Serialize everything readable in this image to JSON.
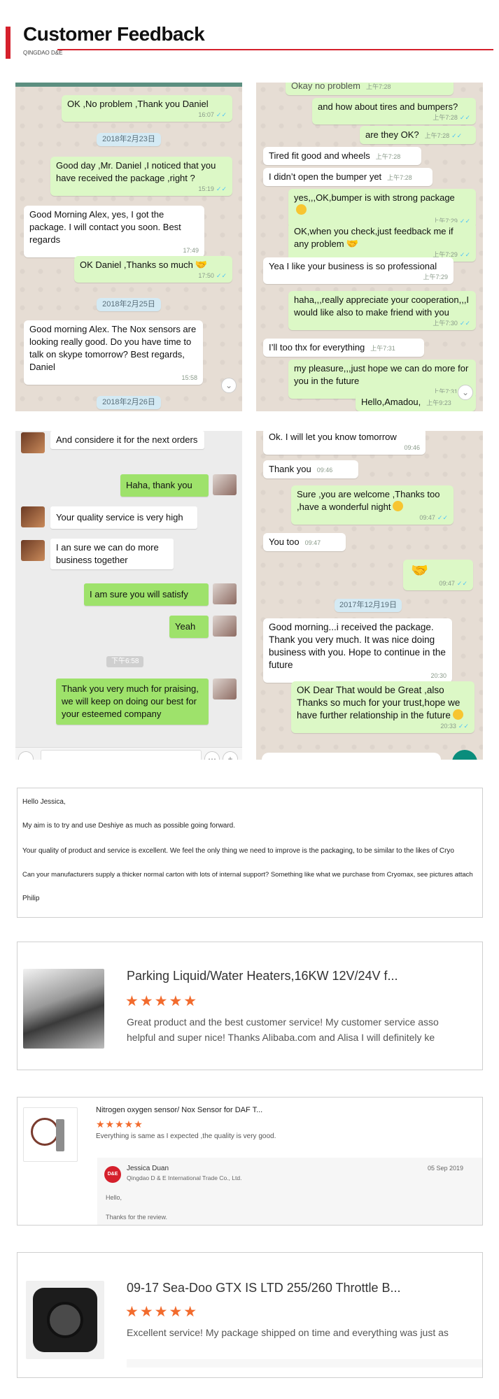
{
  "header": {
    "title": "Customer Feedback",
    "subtitle": "QINGDAO D&E"
  },
  "chat1": {
    "top": "Okay no problem",
    "top_time": "上午7:28",
    "msgs": [
      {
        "text": "OK ,No problem ,Thank you Daniel",
        "time": "16:07"
      },
      {
        "text": "2018年2月23日"
      },
      {
        "text": "Good day ,Mr. Daniel ,I noticed that you have received the package ,right ?",
        "time": "15:19"
      },
      {
        "text": "Good Morning Alex, yes, I got the package. I will contact you soon. Best regards",
        "time": "17:49"
      },
      {
        "text": "OK Daniel ,Thanks so much",
        "time": "17:50"
      },
      {
        "text": "2018年2月25日"
      },
      {
        "text": "Good morning Alex. The Nox sensors are looking really good. Do you have time to talk on skype tomorrow? Best regards, Daniel",
        "time": "15:58"
      },
      {
        "text": "2018年2月26日"
      }
    ]
  },
  "chat2": {
    "msgs": [
      {
        "text": "and how about tires and bumpers?",
        "time": "上午7:28"
      },
      {
        "text": "are they OK?",
        "time": "上午7:28"
      },
      {
        "text": "Tired fit good and wheels",
        "time": "上午7:28"
      },
      {
        "text": "I didn’t open the bumper yet",
        "time": "上午7:28"
      },
      {
        "text": "yes,,,OK,bumper is with strong package",
        "time": "上午7:29"
      },
      {
        "text": "OK,when you check,just feedback me if any problem",
        "time": "上午7:29"
      },
      {
        "text": "Yea I like your business is so professional",
        "time": "上午7:29"
      },
      {
        "text": "haha,,,really appreciate your cooperation,,,I would like also to make friend with you",
        "time": "上午7:30"
      },
      {
        "text": "I’ll too thx for everything",
        "time": "上午7:31"
      },
      {
        "text": "my pleasure,,,just hope we can do more for you in the future",
        "time": "上午7:31"
      },
      {
        "text": "Hello,Amadou,",
        "time": "上午9:23"
      }
    ]
  },
  "chat3": {
    "msgs": [
      {
        "text": "And considere it for the next orders"
      },
      {
        "text": "Haha, thank you"
      },
      {
        "text": "Your quality service is very high"
      },
      {
        "text": "I an sure we can do more business together"
      },
      {
        "text": "I am sure you will satisfy"
      },
      {
        "text": "Yeah"
      },
      {
        "text": "下午6:58"
      },
      {
        "text": "Thank you very much for praising, we will keep on doing our best for your esteemed company"
      }
    ]
  },
  "chat4": {
    "msgs": [
      {
        "text": "Ok. I will let you know tomorrow",
        "time": "09:46"
      },
      {
        "text": "Thank you",
        "time": "09:46"
      },
      {
        "text": "Sure ,you are welcome ,Thanks too ,have a wonderful night",
        "time": "09:47"
      },
      {
        "text": "You too",
        "time": "09:47"
      },
      {
        "text": "",
        "time": "09:47"
      },
      {
        "text": "2017年12月19日"
      },
      {
        "text": "Good morning...i received the package. Thank you very much. It was nice doing business with you. Hope to continue in the future",
        "time": "20:30"
      },
      {
        "text": "OK Dear That would be Great ,also Thanks so much for your trust,hope we have further relationship in the future",
        "time": "20:33"
      }
    ]
  },
  "email": {
    "lines": [
      "Hello Jessica,",
      "My aim is to try and use Deshiye as much as possible going forward.",
      "Your quality of product and service is excellent. We feel the only thing we need to improve is the packaging, to be similar to the likes of Cryo",
      "Can your manufacturers supply a thicker normal carton with lots of internal support? Something like what we purchase from Cryomax, see pictures attach",
      "Philip"
    ]
  },
  "review1": {
    "product": "Parking Liquid/Water Heaters,16KW 12V/24V f...",
    "stars": "★★★★★",
    "line1": "Great product and the best customer service!  My customer service asso",
    "line2": "helpful and super nice!  Thanks Alibaba.com and Alisa I will definitely ke"
  },
  "review2": {
    "product": "Nitrogen oxygen sensor/ Nox Sensor for DAF T...",
    "stars": "★★★★★",
    "comment": "Everything is same as I expected ,the quality is very good.",
    "seller": "Jessica Duan",
    "company": "Qingdao D & E International Trade Co., Ltd.",
    "date": "05 Sep 2019",
    "reply1": "Hello,",
    "reply2": "Thanks for the review.",
    "logo": "D&E"
  },
  "review3": {
    "product": "09-17 Sea-Doo GTX IS LTD 255/260 Throttle B...",
    "stars": "★★★★★",
    "comment": "Excellent service!  My package shipped on time and everything was just as"
  },
  "icons": {
    "check": "✓✓",
    "handshake": "🤝",
    "scroll": "⌄",
    "plus": "+",
    "menu": "⋯"
  }
}
